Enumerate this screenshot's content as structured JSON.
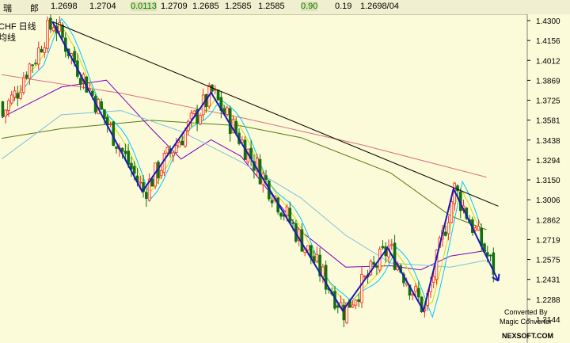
{
  "quote_bar": {
    "cells": [
      {
        "text": "瑞",
        "color": "#000000"
      },
      {
        "text": "郎",
        "color": "#000000"
      },
      {
        "text": "1.2698",
        "color": "#000000"
      },
      {
        "text": "1.2704",
        "color": "#000000"
      },
      {
        "text": "0.0113",
        "color": "#008000"
      },
      {
        "text": "1.2709",
        "color": "#000000"
      },
      {
        "text": "1.2685",
        "color": "#000000"
      },
      {
        "text": "1.2585",
        "color": "#000000"
      },
      {
        "text": "1.2585",
        "color": "#000000"
      },
      {
        "text": "0.90",
        "color": "#008000"
      },
      {
        "text": "0.19",
        "color": "#000000"
      },
      {
        "text": "1.2698/04",
        "color": "#000000"
      }
    ]
  },
  "symbol_labels": {
    "line1": "CHF  日线",
    "line2": "均线"
  },
  "watermark": {
    "line1": "Converted By",
    "line2": "Magic Converter",
    "line3": "NEXSOFT.COM"
  },
  "colors": {
    "background": "#fbfbd9",
    "up_candle": "#ff2020",
    "down_candle": "#107010",
    "zigzag": "#1a1ab4",
    "trendline": "#000000",
    "ma_fast": "#00c8ff",
    "ma_yellow": "#d8d800",
    "ma_purple": "#8000c0",
    "ma_green": "#5a7a10",
    "ma_pink": "#e07080",
    "ma_lightblue": "#80c0e0"
  },
  "chart_data": {
    "type": "candlestick",
    "title": "",
    "xlabel": "",
    "ylabel": "",
    "ylim": [
      1.2175,
      1.4378
    ],
    "y_ticks": [
      "1.4300",
      "1.4156",
      "1.4012",
      "1.3869",
      "1.3725",
      "1.3581",
      "1.3438",
      "1.3294",
      "1.3150",
      "1.3006",
      "1.2862",
      "1.2719",
      "1.2575",
      "1.2431",
      "1.2288",
      "1.2144"
    ],
    "grid": false,
    "n_bars": 165,
    "zigzag": [
      {
        "bar": 17,
        "price": 1.4292
      },
      {
        "bar": 47,
        "price": 1.3065
      },
      {
        "bar": 70,
        "price": 1.378
      },
      {
        "bar": 114,
        "price": 1.2205
      },
      {
        "bar": 129,
        "price": 1.266
      },
      {
        "bar": 141,
        "price": 1.2205
      },
      {
        "bar": 151,
        "price": 1.3085
      },
      {
        "bar": 166,
        "price": 1.242
      }
    ],
    "trendline": [
      {
        "bar": 17,
        "price": 1.4292
      },
      {
        "bar": 166,
        "price": 1.296
      }
    ],
    "moving_averages": [
      {
        "color": "#e07080",
        "points": [
          [
            0,
            1.391
          ],
          [
            40,
            1.3775
          ],
          [
            80,
            1.36
          ],
          [
            120,
            1.3405
          ],
          [
            162,
            1.317
          ]
        ]
      },
      {
        "color": "#5a7a10",
        "points": [
          [
            0,
            1.345
          ],
          [
            20,
            1.352
          ],
          [
            50,
            1.358
          ],
          [
            80,
            1.354
          ],
          [
            100,
            1.3455
          ],
          [
            130,
            1.32
          ],
          [
            150,
            1.289
          ],
          [
            162,
            1.279
          ]
        ]
      },
      {
        "color": "#8000c0",
        "points": [
          [
            0,
            1.36
          ],
          [
            20,
            1.382
          ],
          [
            35,
            1.387
          ],
          [
            50,
            1.352
          ],
          [
            60,
            1.33
          ],
          [
            70,
            1.344
          ],
          [
            80,
            1.332
          ],
          [
            100,
            1.278
          ],
          [
            115,
            1.252
          ],
          [
            130,
            1.253
          ],
          [
            140,
            1.25
          ],
          [
            150,
            1.26
          ],
          [
            162,
            1.264
          ]
        ]
      },
      {
        "color": "#80c0e0",
        "points": [
          [
            0,
            1.33
          ],
          [
            20,
            1.362
          ],
          [
            40,
            1.365
          ],
          [
            60,
            1.35
          ],
          [
            80,
            1.328
          ],
          [
            100,
            1.302
          ],
          [
            115,
            1.275
          ],
          [
            130,
            1.255
          ],
          [
            150,
            1.252
          ],
          [
            162,
            1.257
          ]
        ]
      }
    ]
  }
}
